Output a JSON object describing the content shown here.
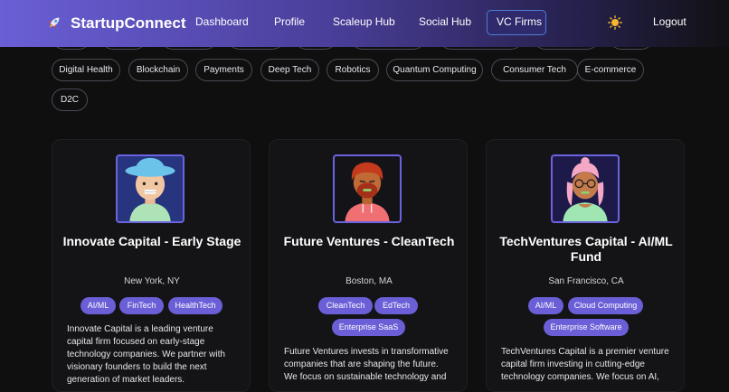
{
  "nav": {
    "brand": "StartupConnect",
    "links": [
      "Dashboard",
      "Profile",
      "Scaleup Hub",
      "Social Hub",
      "VC Firms"
    ],
    "active": "VC Firms",
    "logout": "Logout"
  },
  "filters": [
    "Digital Health",
    "Blockchain",
    "Payments",
    "Deep Tech",
    "Robotics",
    "Quantum Computing",
    "Consumer Tech",
    "E-commerce",
    "D2C"
  ],
  "firms": [
    {
      "name": "Innovate Capital - Early Stage",
      "location": "New York, NY",
      "tags": [
        "AI/ML",
        "FinTech",
        "HealthTech"
      ],
      "description": "Innovate Capital is a leading venture capital firm focused on early-stage technology companies. We partner with visionary founders to build the next generation of market leaders."
    },
    {
      "name": "Future Ventures - CleanTech",
      "location": "Boston, MA",
      "tags": [
        "CleanTech",
        "EdTech",
        "Enterprise SaaS"
      ],
      "description": "Future Ventures invests in transformative companies that are shaping the future. We focus on sustainable technology and"
    },
    {
      "name": "TechVentures Capital - AI/ML Fund",
      "location": "San Francisco, CA",
      "tags": [
        "AI/ML",
        "Cloud Computing",
        "Enterprise Software"
      ],
      "description": "TechVentures Capital is a premier venture capital firm investing in cutting-edge technology companies. We focus on AI,"
    }
  ],
  "colors": {
    "accent": "#6a5fd6",
    "background": "#0f0f10",
    "card": "#141416"
  }
}
